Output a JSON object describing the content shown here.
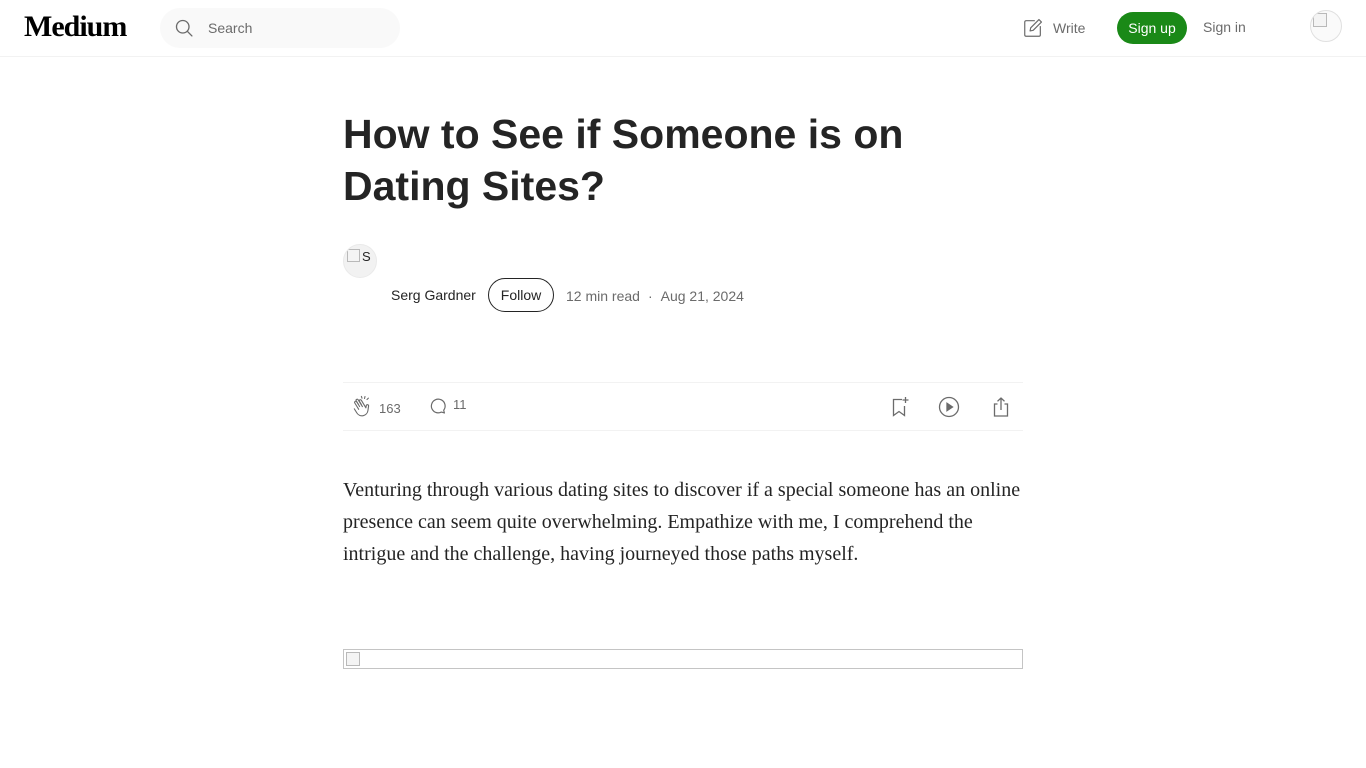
{
  "header": {
    "logo": "Medium",
    "search_placeholder": "Search",
    "write_label": "Write",
    "signup_label": "Sign up",
    "signin_label": "Sign in"
  },
  "article": {
    "title": "How to See if Someone is on Dating Sites?",
    "author": {
      "avatar_alt": "S",
      "name": "Serg Gardner",
      "follow_label": "Follow"
    },
    "read_time": "12 min read",
    "date": "Aug 21, 2024",
    "claps": "163",
    "responses": "11",
    "first_paragraph": "Venturing through various dating sites to discover if a special someone has an online presence can seem quite overwhelming. Empathize with me, I comprehend the intrigue and the challenge, having journeyed those paths myself."
  },
  "colors": {
    "brand_green": "#1a8917",
    "text": "#242424",
    "muted": "#6b6b6b"
  }
}
